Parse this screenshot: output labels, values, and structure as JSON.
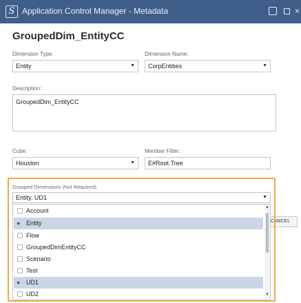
{
  "window": {
    "title": "Application Control Manager - Metadata",
    "logo": "S"
  },
  "heading": "GroupedDim_EntityCC",
  "dimension_type": {
    "label": "Dimension Type:",
    "value": "Entity"
  },
  "dimension_name": {
    "label": "Dimension Name:",
    "value": "CorpEntities"
  },
  "description": {
    "label": "Description:",
    "value": "GroupedDim_EntityCC"
  },
  "cube": {
    "label": "Cube:",
    "value": "Houston"
  },
  "member_filter": {
    "label": "Member Filter:",
    "value": "E#Root.Tree"
  },
  "grouped_dimensions": {
    "label": "Grouped Dimensions (Not Required):",
    "value": "Entity, UD1",
    "options": [
      {
        "label": "Account",
        "checked": false
      },
      {
        "label": "Entity",
        "checked": true
      },
      {
        "label": "Flow",
        "checked": false
      },
      {
        "label": "GroupedDimEntityCC",
        "checked": false
      },
      {
        "label": "Scenario",
        "checked": false
      },
      {
        "label": "Test",
        "checked": false
      },
      {
        "label": "UD1",
        "checked": true
      },
      {
        "label": "UD2",
        "checked": false
      }
    ]
  },
  "cancel_label": "CANCEL",
  "colors": {
    "titlebar": "#3f5e8a",
    "highlight": "#f0a93a",
    "selected_row": "#ccd5e6"
  },
  "icons": {
    "restore": "restore-icon",
    "maximize": "maximize-icon",
    "close": "close-icon",
    "dropdown": "chevron-down-icon"
  }
}
